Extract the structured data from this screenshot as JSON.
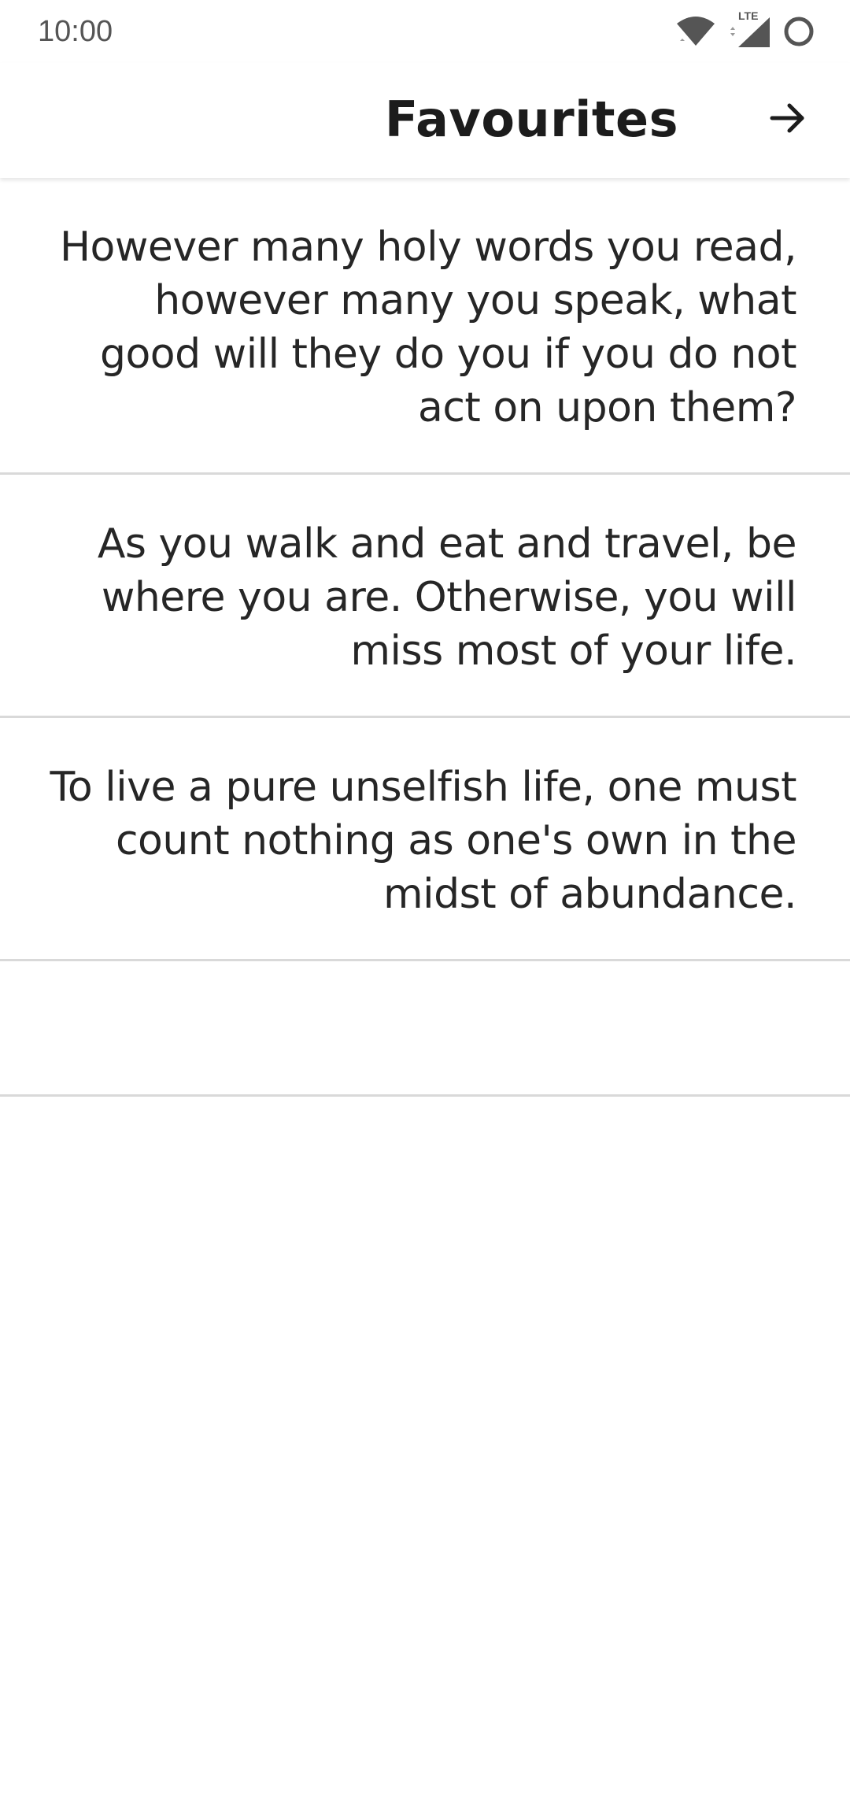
{
  "status_bar": {
    "time": "10:00",
    "network_label": "LTE",
    "icons": [
      "wifi-icon",
      "lte-signal-icon",
      "battery-circle-icon"
    ]
  },
  "app_bar": {
    "title": "Favourites",
    "forward_icon": "arrow-right-icon"
  },
  "quotes": [
    {
      "text": "However many holy words you read, however many you speak, what good will they do you if you do not act on upon them?"
    },
    {
      "text": "As you walk and eat and travel, be where you are. Otherwise, you will miss most of your life."
    },
    {
      "text": "To live a pure unselfish life, one must count nothing as one's own in the midst of abundance."
    }
  ],
  "colors": {
    "background": "#ffffff",
    "text": "#262626",
    "divider": "#d9d9d9",
    "status_text": "#555555"
  }
}
